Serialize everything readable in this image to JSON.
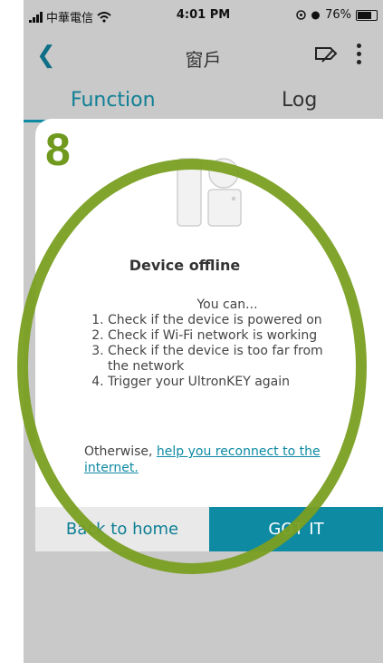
{
  "statusbar": {
    "carrier": "中華電信",
    "time": "4:01 PM",
    "battery": "76%",
    "battery_level": 0.76
  },
  "navbar": {
    "title": "窗戶"
  },
  "tabs": [
    {
      "label": "Function",
      "active": true
    },
    {
      "label": "Log",
      "active": false
    }
  ],
  "dialog": {
    "title": "Device offline",
    "intro": "You can...",
    "steps": [
      "Check if the device is powered on",
      "Check if Wi-Fi network is working",
      "Check if the device is too far from the network",
      "Trigger your UltronKEY again"
    ],
    "otherwise_prefix": "Otherwise,",
    "otherwise_link": "help you reconnect to the internet.",
    "back_button": "Back to home",
    "got_button": "GOT IT"
  },
  "annotation": {
    "number": "8",
    "color": "#6f9a1d"
  },
  "colors": {
    "accent": "#0e8aa3",
    "overlay": "#c9c9c9"
  }
}
